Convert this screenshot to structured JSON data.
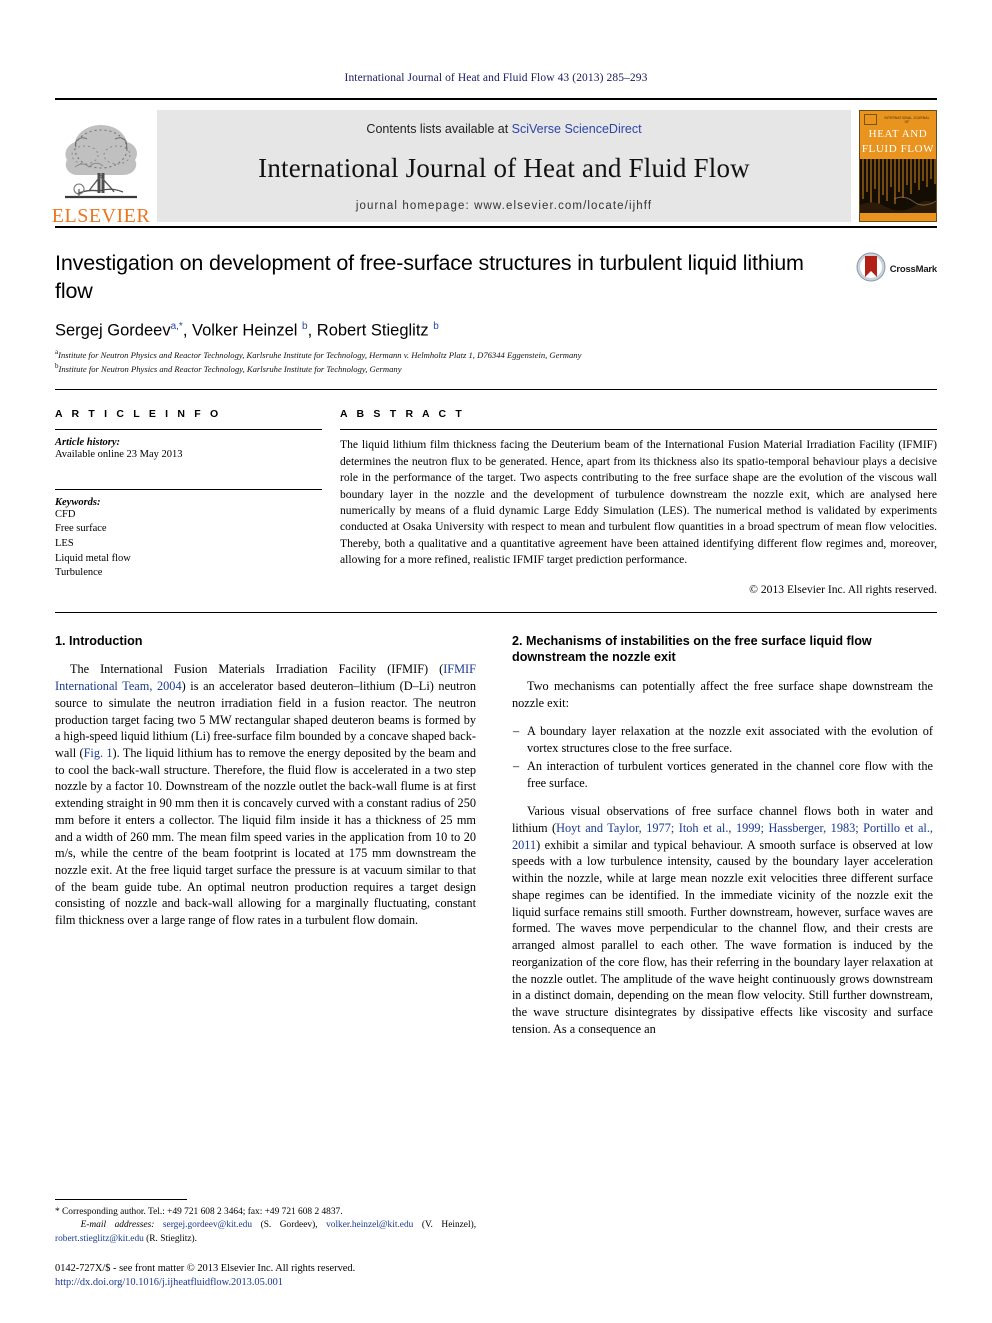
{
  "running_head": "International Journal of Heat and Fluid Flow 43 (2013) 285–293",
  "masthead": {
    "publisher_wordmark": "ELSEVIER",
    "contents_prefix": "Contents lists available at ",
    "contents_link": "SciVerse ScienceDirect",
    "journal_title": "International Journal of Heat and Fluid Flow",
    "homepage": "journal homepage: www.elsevier.com/locate/ijhff",
    "cover": {
      "microtext": "INTERNATIONAL JOURNAL OF",
      "line1": "HEAT AND",
      "line2": "FLUID FLOW"
    }
  },
  "article": {
    "title": "Investigation on development of free-surface structures in turbulent liquid lithium flow",
    "crossmark_label": "CrossMark",
    "authors_html": "Sergej Gordeev<sup>a,*</sup>, Volker Heinzel <sup>b</sup>, Robert Stieglitz <sup>b</sup>",
    "affiliations": [
      {
        "marker": "a",
        "text": "Institute for Neutron Physics and Reactor Technology, Karlsruhe Institute for Technology, Hermann v. Helmholtz Platz 1, D76344 Eggenstein, Germany"
      },
      {
        "marker": "b",
        "text": "Institute for Neutron Physics and Reactor Technology, Karlsruhe Institute for Technology, Germany"
      }
    ]
  },
  "article_info": {
    "heading": "A R T I C L E   I N F O",
    "history_label": "Article history:",
    "history_value": "Available online 23 May 2013",
    "keywords_label": "Keywords:",
    "keywords": [
      "CFD",
      "Free surface",
      "LES",
      "Liquid metal flow",
      "Turbulence"
    ]
  },
  "abstract": {
    "heading": "A B S T R A C T",
    "text": "The liquid lithium film thickness facing the Deuterium beam of the International Fusion Material Irradiation Facility (IFMIF) determines the neutron flux to be generated. Hence, apart from its thickness also its spatio-temporal behaviour plays a decisive role in the performance of the target. Two aspects contributing to the free surface shape are the evolution of the viscous wall boundary layer in the nozzle and the development of turbulence downstream the nozzle exit, which are analysed here numerically by means of a fluid dynamic Large Eddy Simulation (LES). The numerical method is validated by experiments conducted at Osaka University with respect to mean and turbulent flow quantities in a broad spectrum of mean flow velocities. Thereby, both a qualitative and a quantitative agreement have been attained identifying different flow regimes and, moreover, allowing for a more refined, realistic IFMIF target prediction performance.",
    "copyright": "© 2013 Elsevier Inc. All rights reserved."
  },
  "sections": {
    "intro": {
      "heading": "1. Introduction",
      "p1_a": "The International Fusion Materials Irradiation Facility (IFMIF) (",
      "p1_ref": "IFMIF International Team, 2004",
      "p1_b": ") is an accelerator based deuteron–lithium (D–Li) neutron source to simulate the neutron irradiation field in a fusion reactor. The neutron production target facing two 5 MW rectangular shaped deuteron beams is formed by a high-speed liquid lithium (Li) free-surface film bounded by a concave shaped back-wall (",
      "p1_figref": "Fig. 1",
      "p1_c": "). The liquid lithium has to remove the energy deposited by the beam and to cool the back-wall structure. Therefore, the fluid flow is accelerated in a two step nozzle by a factor 10. Downstream of the nozzle outlet the back-wall flume is at first extending straight in 90 mm then it is concavely curved with a constant radius of 250 mm before it enters a collector. The liquid film inside it has a thickness of 25 mm and a width of 260 mm. The mean film speed varies in the application from 10 to 20 m/s, while the centre of the beam footprint is located at 175 mm downstream the nozzle exit. At the free liquid target surface the pressure is at vacuum similar to that of the beam guide tube. An optimal neutron production requires a target design consisting of nozzle and back-wall allowing for a marginally fluctuating, constant film thickness over a large range of flow rates in a turbulent flow domain."
    },
    "mechanisms": {
      "heading": "2. Mechanisms of instabilities on the free surface liquid flow downstream the nozzle exit",
      "intro_p": "Two mechanisms can potentially affect the free surface shape downstream the nozzle exit:",
      "bullets": [
        "A boundary layer relaxation at the nozzle exit associated with the evolution of vortex structures close to the free surface.",
        "An interaction of turbulent vortices generated in the channel core flow with the free surface."
      ],
      "p2_a": "Various visual observations of free surface channel flows both in water and lithium (",
      "p2_refs": "Hoyt and Taylor, 1977; Itoh et al., 1999; Hassberger, 1983; Portillo et al., 2011",
      "p2_b": ") exhibit a similar and typical behaviour. A smooth surface is observed at low speeds with a low turbulence intensity, caused by the boundary layer acceleration within the nozzle, while at large mean nozzle exit velocities three different surface shape regimes can be identified. In the immediate vicinity of the nozzle exit the liquid surface remains still smooth. Further downstream, however, surface waves are formed. The waves move perpendicular to the channel flow, and their crests are arranged almost parallel to each other. The wave formation is induced by the reorganization of the core flow, has their referring in the boundary layer relaxation at the nozzle outlet. The amplitude of the wave height continuously grows downstream in a distinct domain, depending on the mean flow velocity. Still further downstream, the wave structure disintegrates by dissipative effects like viscosity and surface tension. As a consequence an"
    }
  },
  "footer": {
    "corresponding": "* Corresponding author. Tel.: +49 721 608 2 3464; fax: +49 721 608 2 4837.",
    "email_label": "E-mail addresses:",
    "emails": [
      {
        "address": "sergej.gordeev@kit.edu",
        "owner": "(S. Gordeev)"
      },
      {
        "address": "volker.heinzel@kit.edu",
        "owner": "(V. Heinzel)"
      },
      {
        "address": "robert.stieglitz@kit.edu",
        "owner": "(R. Stieglitz)"
      }
    ],
    "issn_line": "0142-727X/$ - see front matter © 2013 Elsevier Inc. All rights reserved.",
    "doi": "http://dx.doi.org/10.1016/j.ijheatfluidflow.2013.05.001"
  },
  "colors": {
    "elsevier_orange": "#E87722",
    "link_blue": "#1a3a8f",
    "sd_blue": "#2b46a6",
    "band_gray": "#e6e6e6",
    "crossmark_red": "#B22018"
  }
}
